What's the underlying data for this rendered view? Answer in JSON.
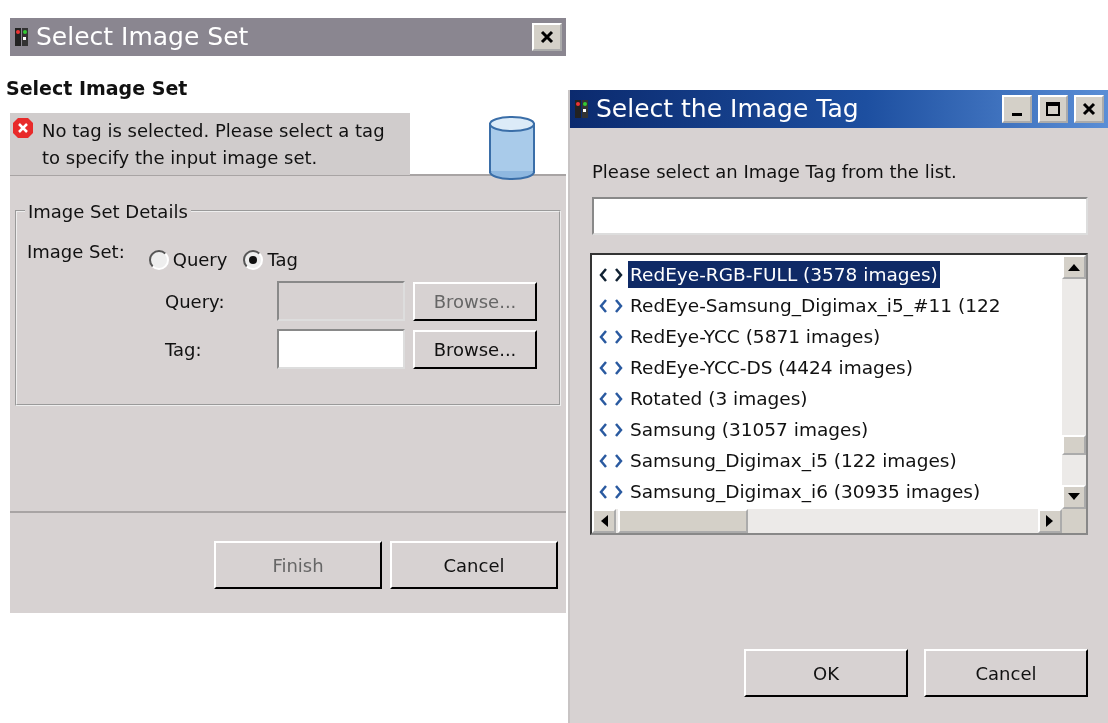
{
  "image_set_dialog": {
    "title": "Select Image Set",
    "active": false,
    "heading": "Select Image Set",
    "error_message": "No tag is selected. Please select a tag to specify the input image set.",
    "group_title": "Image Set Details",
    "image_set_label": "Image Set:",
    "radios": [
      {
        "label": "Query",
        "selected": false
      },
      {
        "label": "Tag",
        "selected": true
      }
    ],
    "fields": [
      {
        "label": "Query:",
        "disabled": true,
        "button": "Browse..."
      },
      {
        "label": "Tag:",
        "disabled": false,
        "button": "Browse..."
      }
    ],
    "buttons": [
      {
        "label": "Finish",
        "disabled": true
      },
      {
        "label": "Cancel",
        "disabled": false
      }
    ]
  },
  "tag_dialog": {
    "title": "Select the Image Tag",
    "active": true,
    "instruction": "Please select an Image Tag from the list.",
    "items": [
      {
        "label": "RedEye-RGB-FULL (3578 images)",
        "selected": true
      },
      {
        "label": "RedEye-Samsung_Digimax_i5_#11 (122",
        "selected": false
      },
      {
        "label": "RedEye-YCC (5871 images)",
        "selected": false
      },
      {
        "label": "RedEye-YCC-DS (4424 images)",
        "selected": false
      },
      {
        "label": "Rotated (3 images)",
        "selected": false
      },
      {
        "label": "Samsung (31057 images)",
        "selected": false
      },
      {
        "label": "Samsung_Digimax_i5 (122 images)",
        "selected": false
      },
      {
        "label": "Samsung_Digimax_i6 (30935 images)",
        "selected": false
      }
    ],
    "buttons": [
      {
        "label": "OK"
      },
      {
        "label": "Cancel"
      }
    ]
  }
}
